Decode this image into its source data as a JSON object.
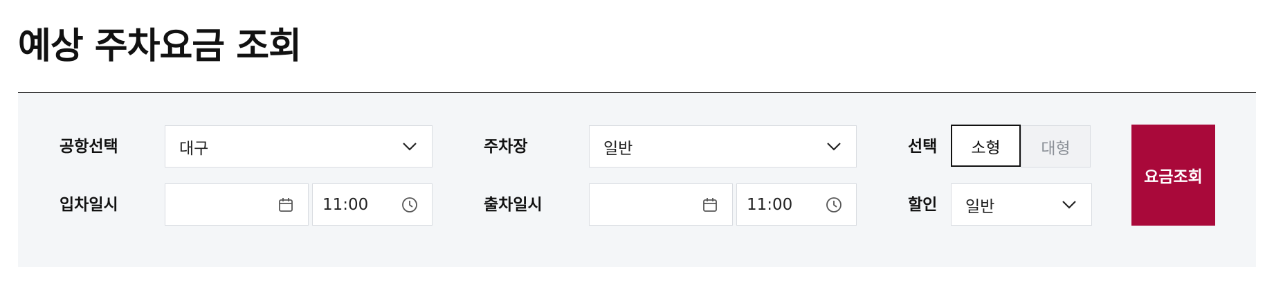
{
  "page": {
    "title": "예상 주차요금 조회"
  },
  "form": {
    "airport": {
      "label": "공항선택",
      "value": "대구",
      "icon": "chevron-down-icon"
    },
    "parking_lot": {
      "label": "주차장",
      "value": "일반",
      "icon": "chevron-down-icon"
    },
    "vehicle_type": {
      "label": "선택",
      "options": [
        "소형",
        "대형"
      ],
      "selected": "소형"
    },
    "entry": {
      "label": "입차일시",
      "date_value": "",
      "date_icon": "calendar-icon",
      "time_value": "11:00",
      "time_icon": "clock-icon"
    },
    "exit": {
      "label": "출차일시",
      "date_value": "",
      "date_icon": "calendar-icon",
      "time_value": "11:00",
      "time_icon": "clock-icon"
    },
    "discount": {
      "label": "할인",
      "value": "일반",
      "icon": "chevron-down-icon"
    },
    "submit_label": "요금조회"
  },
  "colors": {
    "accent": "#a9093a",
    "panel_background": "#f4f6f8",
    "border": "#d9dce1"
  }
}
